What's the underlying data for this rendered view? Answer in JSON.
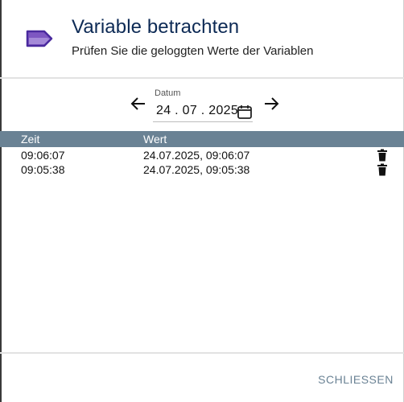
{
  "dialog": {
    "icon": "label-tag-icon",
    "title": "Variable betrachten",
    "subtitle": "Prüfen Sie die geloggten Werte der Variablen"
  },
  "date_picker": {
    "label": "Datum",
    "value": "24 . 07 . 2025",
    "prev_icon": "arrow-left-icon",
    "next_icon": "arrow-right-icon",
    "calendar_icon": "calendar-icon"
  },
  "table": {
    "columns": [
      "Zeit",
      "Wert"
    ],
    "rows": [
      {
        "zeit": "09:06:07",
        "wert": "24.07.2025, 09:06:07"
      },
      {
        "zeit": "09:05:38",
        "wert": "24.07.2025, 09:05:38"
      }
    ],
    "delete_icon": "trash-icon"
  },
  "footer": {
    "close_label": "SCHLIESSEN"
  },
  "colors": {
    "accent": "#6a8294",
    "title": "#0d2a55",
    "icon_purple": "#7e57c2"
  }
}
